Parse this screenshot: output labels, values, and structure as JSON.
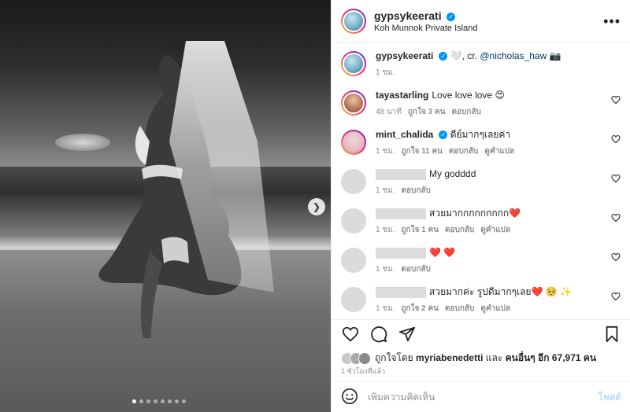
{
  "post": {
    "username": "gypsykeerati",
    "location": "Koh Munnok Private Island",
    "caption_user": "gypsykeerati",
    "caption_text": "🤍, cr. ",
    "caption_mention": "@nicholas_haw",
    "caption_emoji": "📷",
    "caption_time": "1 ชม.",
    "image_alt": "black and white beach photo with bridal veil",
    "carousel_dots": 8,
    "carousel_active": 0
  },
  "comments": [
    {
      "user": "taya",
      "username": "tayastarling",
      "verified": false,
      "text": "Love love love 😍",
      "time": "48 นาที",
      "likes": "ถูกใจ 3 คน",
      "reply": "ตอบกลับ",
      "translate": ""
    },
    {
      "user": "mint",
      "username": "mint_chalida",
      "verified": true,
      "text": "ดีย์มากๆเลยค่า",
      "time": "1 ชม.",
      "likes": "ถูกใจ 11 คน",
      "reply": "ตอบกลับ",
      "translate": "ดูคำแปล"
    },
    {
      "user": "blur",
      "username": "",
      "verified": false,
      "text": "My godddd",
      "time": "1 ชม.",
      "likes": "",
      "reply": "ตอบกลับ",
      "translate": ""
    },
    {
      "user": "blur",
      "username": "",
      "verified": false,
      "text": "สวยมากกกกกกกกก❤️",
      "time": "1 ชม.",
      "likes": "ถูกใจ 1 คน",
      "reply": "ตอบกลับ",
      "translate": "ดูคำแปล"
    },
    {
      "user": "blur",
      "username": "",
      "verified": false,
      "text": "❤️ ❤️",
      "time": "1 ชม.",
      "likes": "",
      "reply": "ตอบกลับ",
      "translate": ""
    },
    {
      "user": "blur",
      "username": "",
      "verified": false,
      "text": "สวยมากค่ะ รูปดีมากๆเลย❤️ 🥺 ✨",
      "time": "1 ชม.",
      "likes": "ถูกใจ 2 คน",
      "reply": "ตอบกลับ",
      "translate": "ดูคำแปล"
    }
  ],
  "likes": {
    "prefix": "ถูกใจโดย",
    "user": "myriabenedetti",
    "middle": "และ",
    "others": "คนอื่นๆ อีก 67,971 คน"
  },
  "time_ago": "1 ชั่วโมงที่แล้ว",
  "add_comment": {
    "placeholder": "เพิ่มความคิดเห็น",
    "post_label": "โพสต์"
  },
  "icons": [
    "heart-icon",
    "comment-icon",
    "share-icon",
    "bookmark-icon",
    "emoji-icon",
    "more-icon",
    "chevron-right-icon"
  ]
}
